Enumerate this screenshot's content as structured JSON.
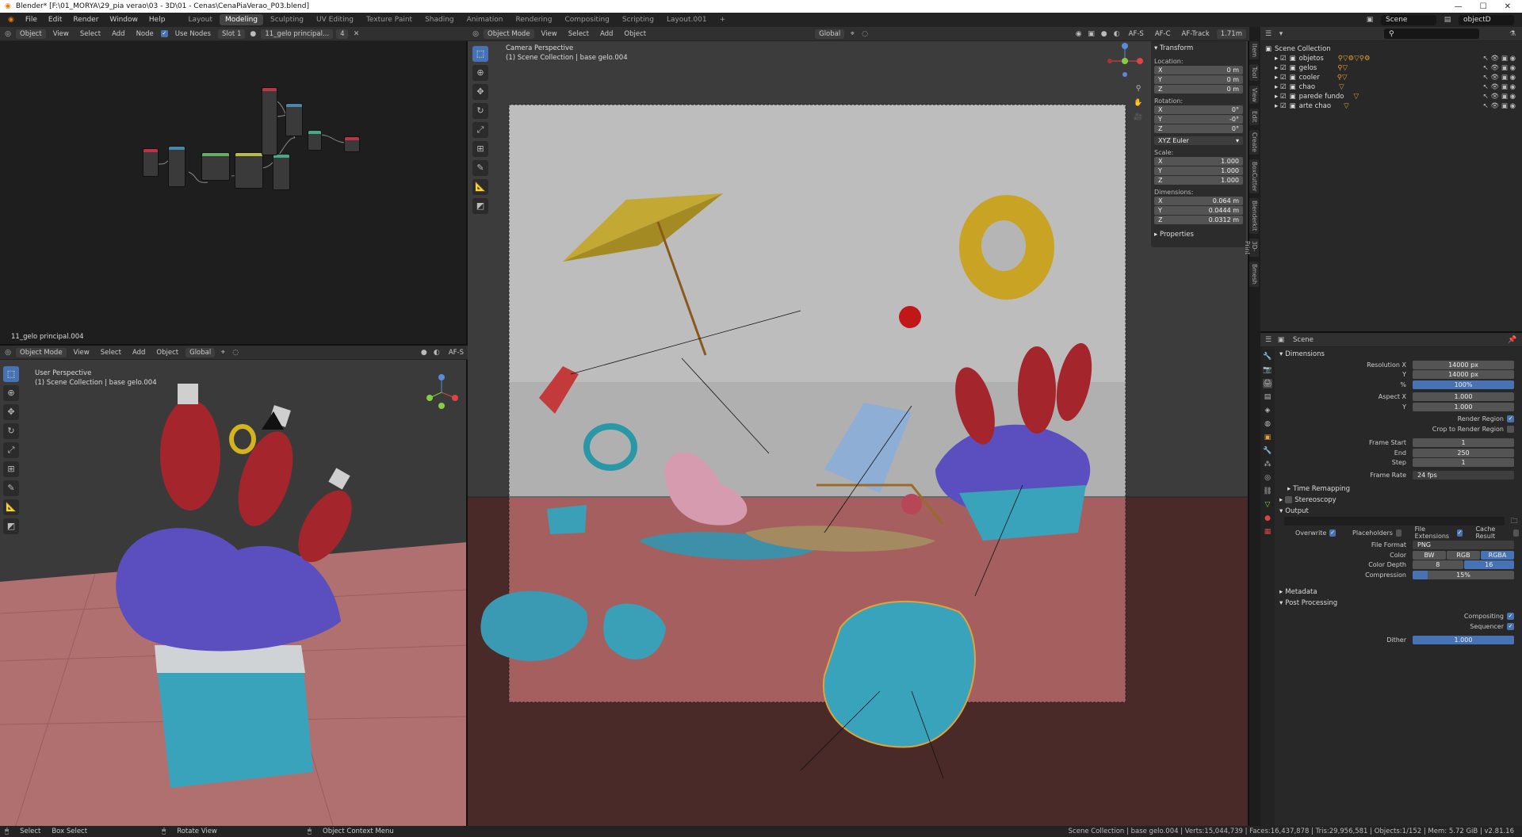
{
  "app": {
    "title": "Blender* [F:\\01_MORYA\\29_pia verao\\03 - 3D\\01 - Cenas\\CenaPiaVerao_P03.blend]"
  },
  "menu": [
    "File",
    "Edit",
    "Render",
    "Window",
    "Help"
  ],
  "workspaces": [
    "Layout",
    "Modeling",
    "Sculpting",
    "UV Editing",
    "Texture Paint",
    "Shading",
    "Animation",
    "Rendering",
    "Compositing",
    "Scripting",
    "Layout.001"
  ],
  "active_workspace": "Modeling",
  "scene_field": "Scene",
  "viewlayer_field": "objectD",
  "node_editor": {
    "object_mode": "Object",
    "menus": [
      "View",
      "Select",
      "Add",
      "Node"
    ],
    "use_nodes": "Use Nodes",
    "slot": "Slot 1",
    "material": "11_gelo principal...",
    "user_count": "4",
    "footer_label": "11_gelo principal.004"
  },
  "viewport_left": {
    "mode": "Object Mode",
    "menus": [
      "View",
      "Select",
      "Add",
      "Object"
    ],
    "orientation": "Global",
    "perspective": "User Perspective",
    "collection": "(1) Scene Collection | base gelo.004",
    "af": "AF-S"
  },
  "viewport_main": {
    "mode": "Object Mode",
    "menus": [
      "View",
      "Select",
      "Add",
      "Object"
    ],
    "orientation": "Global",
    "perspective": "Camera Perspective",
    "collection": "(1) Scene Collection | base gelo.004",
    "af_s": "AF-S",
    "af_c": "AF-C",
    "af_track": "AF-Track",
    "distance": "1.71m"
  },
  "transform_panel": {
    "title": "Transform",
    "location_label": "Location:",
    "location": [
      {
        "axis": "X",
        "value": "0 m"
      },
      {
        "axis": "Y",
        "value": "0 m"
      },
      {
        "axis": "Z",
        "value": "0 m"
      }
    ],
    "rotation_label": "Rotation:",
    "rotation": [
      {
        "axis": "X",
        "value": "0°"
      },
      {
        "axis": "Y",
        "value": "-0°"
      },
      {
        "axis": "Z",
        "value": "0°"
      }
    ],
    "rotation_mode": "XYZ Euler",
    "scale_label": "Scale:",
    "scale": [
      {
        "axis": "X",
        "value": "1.000"
      },
      {
        "axis": "Y",
        "value": "1.000"
      },
      {
        "axis": "Z",
        "value": "1.000"
      }
    ],
    "dimensions_label": "Dimensions:",
    "dimensions": [
      {
        "axis": "X",
        "value": "0.064 m"
      },
      {
        "axis": "Y",
        "value": "0.0444 m"
      },
      {
        "axis": "Z",
        "value": "0.0312 m"
      }
    ],
    "properties": "Properties"
  },
  "side_tabs": [
    "Item",
    "Tool",
    "View",
    "Edit",
    "Create",
    "BoxCutter",
    "Blenderkit",
    "3D-Print",
    "Bmesh"
  ],
  "outliner": {
    "root": "Scene Collection",
    "items": [
      "objetos",
      "gelos",
      "cooler",
      "chao",
      "parede fundo",
      "arte chao"
    ]
  },
  "properties": {
    "scene": "Scene",
    "dimensions": "Dimensions",
    "resolution_x_label": "Resolution X",
    "resolution_x": "14000 px",
    "resolution_y_label": "Y",
    "resolution_y": "14000 px",
    "percent_label": "%",
    "percent": "100%",
    "aspect_x_label": "Aspect X",
    "aspect_x": "1.000",
    "aspect_y_label": "Y",
    "aspect_y": "1.000",
    "render_region": "Render Region",
    "crop_region": "Crop to Render Region",
    "frame_start_label": "Frame Start",
    "frame_start": "1",
    "end_label": "End",
    "end": "250",
    "step_label": "Step",
    "step": "1",
    "frame_rate_label": "Frame Rate",
    "frame_rate": "24 fps",
    "time_remapping": "Time Remapping",
    "stereoscopy": "Stereoscopy",
    "output": "Output",
    "overwrite": "Overwrite",
    "placeholders": "Placeholders",
    "file_extensions": "File Extensions",
    "cache_result": "Cache Result",
    "file_format_label": "File Format",
    "file_format": "PNG",
    "color_label": "Color",
    "color_opts": [
      "BW",
      "RGB",
      "RGBA"
    ],
    "depth_label": "Color Depth",
    "depth_opts": [
      "8",
      "16"
    ],
    "compression_label": "Compression",
    "compression": "15%",
    "metadata": "Metadata",
    "post_processing": "Post Processing",
    "compositing": "Compositing",
    "sequencer": "Sequencer",
    "dither_label": "Dither",
    "dither": "1.000"
  },
  "statusbar": {
    "select": "Select",
    "box_select": "Box Select",
    "rotate_view": "Rotate View",
    "context_menu": "Object Context Menu",
    "stats": "Scene Collection | base gelo.004 | Verts:15,044,739 | Faces:16,437,878 | Tris:29,956,581 | Objects:1/152 | Mem: 5.72 GiB | v2.81.16"
  }
}
